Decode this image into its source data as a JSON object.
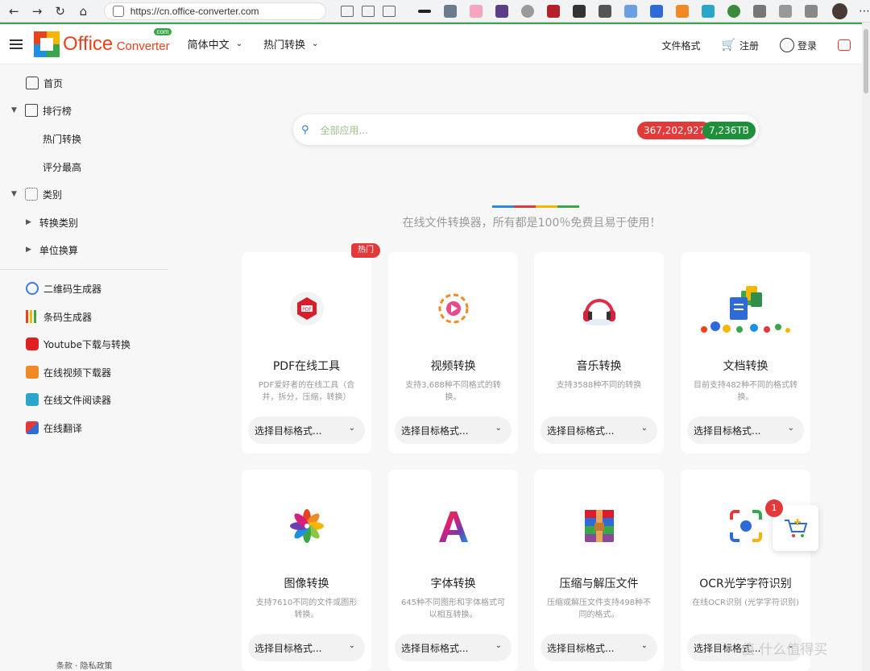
{
  "browser": {
    "url": "https://cn.office-converter.com"
  },
  "header": {
    "logo_main": "Office",
    "logo_sub": "Converter",
    "logo_tld": "com",
    "nav": [
      "简体中文",
      "热门转换"
    ],
    "right_links": {
      "formats": "文件格式",
      "register": "注册",
      "login": "登录"
    }
  },
  "sidebar": {
    "home": "首页",
    "ranking": "排行榜",
    "ranking_children": [
      "热门转换",
      "评分最高"
    ],
    "categories": "类别",
    "category_children": [
      "转换类别",
      "单位换算"
    ],
    "tools": [
      "二维码生成器",
      "条码生成器",
      "Youtube下载与转换",
      "在线视频下载器",
      "在线文件阅读器",
      "在线翻译"
    ],
    "footer": "条款 · 隐私政策"
  },
  "search": {
    "placeholder": "全部应用...",
    "count_red": "367,202,927",
    "count_green": "7,236TB"
  },
  "tagline": "在线文件转换器，所有都是100％免费且易于使用！",
  "hot_tag": "热门",
  "select_label": "选择目标格式...",
  "cards": [
    {
      "title": "PDF在线工具",
      "desc": "PDF爱好者的在线工具（合并，拆分，压缩，转换）"
    },
    {
      "title": "视频转换",
      "desc": "支持3,688种不同格式的转换。"
    },
    {
      "title": "音乐转换",
      "desc": "支持3588种不同的转换"
    },
    {
      "title": "文档转换",
      "desc": "目前支持482种不同的格式转换。"
    },
    {
      "title": "图像转换",
      "desc": "支持7610不同的文件或图形转换。"
    },
    {
      "title": "字体转换",
      "desc": "645种不同图形和字体格式可以相互转换。"
    },
    {
      "title": "压缩与解压文件",
      "desc": "压缩或解压文件支持498种不同的格式。"
    },
    {
      "title": "OCR光学字符识别",
      "desc": "在线OCR识别 (光学字符识别)"
    }
  ],
  "float_badge": "1",
  "watermark": "值 什么值得买",
  "colors": {
    "accent_green": "#3aa64a",
    "hot_red": "#e23a3a",
    "badge_green": "#1f8f3c"
  }
}
